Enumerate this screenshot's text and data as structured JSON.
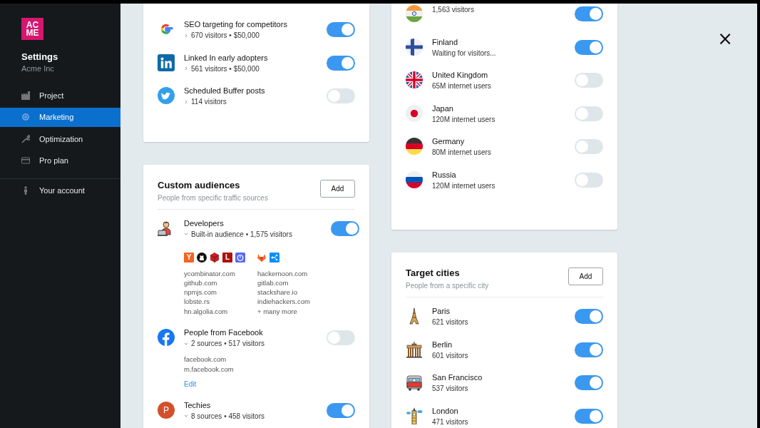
{
  "sidebar": {
    "logo_lines": [
      "AC",
      "ME"
    ],
    "title": "Settings",
    "subtitle": "Acme Inc",
    "items": [
      {
        "label": "Project",
        "selected": false
      },
      {
        "label": "Marketing",
        "selected": true
      },
      {
        "label": "Optimization",
        "selected": false
      },
      {
        "label": "Pro plan",
        "selected": false
      }
    ],
    "account_items": [
      {
        "label": "Your account",
        "selected": false
      }
    ]
  },
  "close_button": "×",
  "columns": [
    {
      "cards": [
        {
          "kind": "campaigns",
          "rows": [
            {
              "name": "SEO targeting for competitors",
              "meta": "670 visitors • $50,000",
              "expanded": false,
              "on": true
            },
            {
              "name": "Linked In early adopters",
              "meta": "561 visitors • $50,000",
              "expanded": false,
              "on": true
            },
            {
              "name": "Scheduled Buffer posts",
              "meta": "114 visitors",
              "expanded": false,
              "on": false
            }
          ]
        },
        {
          "kind": "audiences",
          "title": "Custom audiences",
          "subtitle": "People from specific traffic sources",
          "add_button": "Add",
          "rows": [
            {
              "name": "Developers",
              "meta": "Built-in audience • 1,575 visitors",
              "expanded": true,
              "on": true,
              "source_icons": [
                {
                  "kind": "letter",
                  "text": "Y",
                  "color": "#f26522"
                },
                {
                  "kind": "github"
                },
                {
                  "kind": "cube"
                },
                {
                  "kind": "letter",
                  "text": "L",
                  "color": "#ac130d"
                },
                {
                  "kind": "timer"
                },
                {
                  "kind": "fox"
                },
                {
                  "kind": "nodes"
                }
              ],
              "source_columns": [
                [
                  "ycombinator.com",
                  "github.com",
                  "npmjs.com",
                  "lobste.rs",
                  "hn.algolia.com"
                ],
                [
                  "hackernoon.com",
                  "gitlab.com",
                  "stackshare.io",
                  "indiehackers.com",
                  "+ many more"
                ]
              ]
            },
            {
              "name": "People from Facebook",
              "meta": "2 sources • 517 visitors",
              "expanded": true,
              "on": false,
              "source_columns": [
                [
                  "facebook.com",
                  "m.facebook.com"
                ]
              ],
              "edit_link": "Edit"
            },
            {
              "name": "Techies",
              "meta": "8 sources • 458 visitors",
              "expanded": true,
              "on": true,
              "avatar": "P"
            }
          ]
        }
      ]
    },
    {
      "cards": [
        {
          "kind": "countries",
          "rows": [
            {
              "meta": "1,563 visitors",
              "on": true
            },
            {
              "name": "Finland",
              "meta": "Waiting for visitors...",
              "on": true
            },
            {
              "name": "United Kingdom",
              "meta": "65M internet users",
              "on": false
            },
            {
              "name": "Japan",
              "meta": "120M internet users",
              "on": false
            },
            {
              "name": "Germany",
              "meta": "80M internet users",
              "on": false
            },
            {
              "name": "Russia",
              "meta": "120M internet users",
              "on": false
            }
          ]
        },
        {
          "kind": "cities",
          "title": "Target cities",
          "subtitle": "People from a specific city",
          "add_button": "Add",
          "rows": [
            {
              "name": "Paris",
              "meta": "621 visitors",
              "on": true
            },
            {
              "name": "Berlin",
              "meta": "601 visitors",
              "on": true
            },
            {
              "name": "San Francisco",
              "meta": "537 visitors",
              "on": true
            },
            {
              "name": "London",
              "meta": "471 visitors",
              "on": true
            }
          ]
        }
      ]
    }
  ]
}
